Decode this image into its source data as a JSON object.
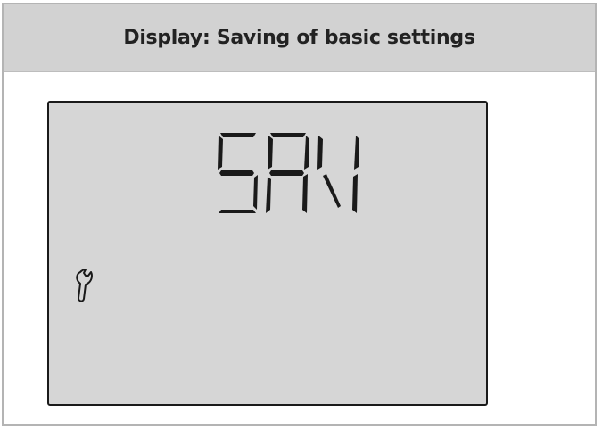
{
  "header": {
    "title": "Display: Saving of basic settings"
  },
  "lcd": {
    "display_text": "SAV",
    "icons": [
      "wrench-icon"
    ],
    "colors": {
      "background": "#d6d6d6",
      "segment": "#1a1a1a",
      "border": "#1a1a1a"
    }
  },
  "frame": {
    "header_background": "#d2d2d2",
    "border_color": "#b4b4b4"
  }
}
